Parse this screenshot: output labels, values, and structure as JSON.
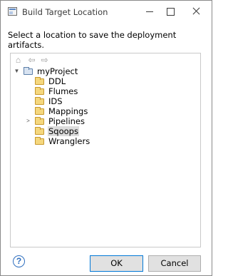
{
  "window": {
    "title": "Build Target Location",
    "icon": "dialog-window-icon"
  },
  "prompt": "Select a location to save the deployment artifacts.",
  "toolbar": {
    "home_glyph": "⌂",
    "back_glyph": "⇦",
    "forward_glyph": "⇨"
  },
  "tree": {
    "root": {
      "label": "myProject",
      "expanded": true
    },
    "children": [
      {
        "label": "DDL",
        "expandable": false
      },
      {
        "label": "Flumes",
        "expandable": false
      },
      {
        "label": "IDS",
        "expandable": false
      },
      {
        "label": "Mappings",
        "expandable": false
      },
      {
        "label": "Pipelines",
        "expandable": true
      },
      {
        "label": "Sqoops",
        "expandable": false,
        "selected": true
      },
      {
        "label": "Wranglers",
        "expandable": false
      }
    ]
  },
  "buttons": {
    "help": "?",
    "ok": "OK",
    "cancel": "Cancel"
  },
  "colors": {
    "accent": "#0078d7",
    "selection": "#dcdcdc",
    "folder": "#f5d77d"
  }
}
